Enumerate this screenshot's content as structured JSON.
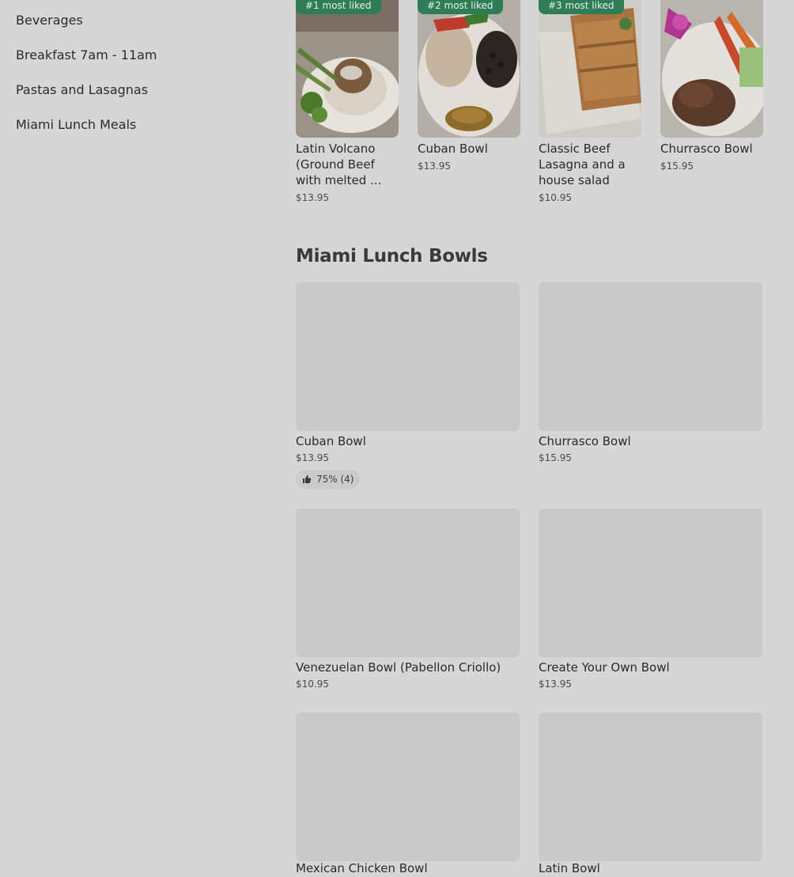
{
  "sidebar": {
    "items": [
      {
        "label": "Beverages"
      },
      {
        "label": "Breakfast 7am - 11am"
      },
      {
        "label": "Pastas and Lasagnas"
      },
      {
        "label": "Miami Lunch Meals"
      }
    ]
  },
  "most_liked": [
    {
      "badge": "#1 most liked",
      "name": "Latin Volcano (Ground Beef with melted ...",
      "price": "$13.95"
    },
    {
      "badge": "#2 most liked",
      "name": "Cuban Bowl",
      "price": "$13.95"
    },
    {
      "badge": "#3 most liked",
      "name": "Classic Beef Lasagna and a house salad",
      "price": "$10.95"
    },
    {
      "badge": "",
      "name": "Churrasco Bowl",
      "price": "$15.95"
    }
  ],
  "section": {
    "title": "Miami Lunch Bowls",
    "items": [
      {
        "name": "Cuban Bowl",
        "price": "$13.95",
        "rating": "75% (4)"
      },
      {
        "name": "Churrasco Bowl",
        "price": "$15.95"
      },
      {
        "name": "Venezuelan Bowl (Pabellon Criollo)",
        "price": "$10.95"
      },
      {
        "name": "Create Your Own Bowl",
        "price": "$13.95"
      },
      {
        "name": "Mexican Chicken Bowl"
      },
      {
        "name": "Latin Bowl"
      }
    ]
  },
  "colors": {
    "background": "#d6d6d6",
    "badge": "#2e7d57",
    "placeholder": "#c9c9c9"
  },
  "icons": {
    "rating": "thumbs-up-icon"
  }
}
